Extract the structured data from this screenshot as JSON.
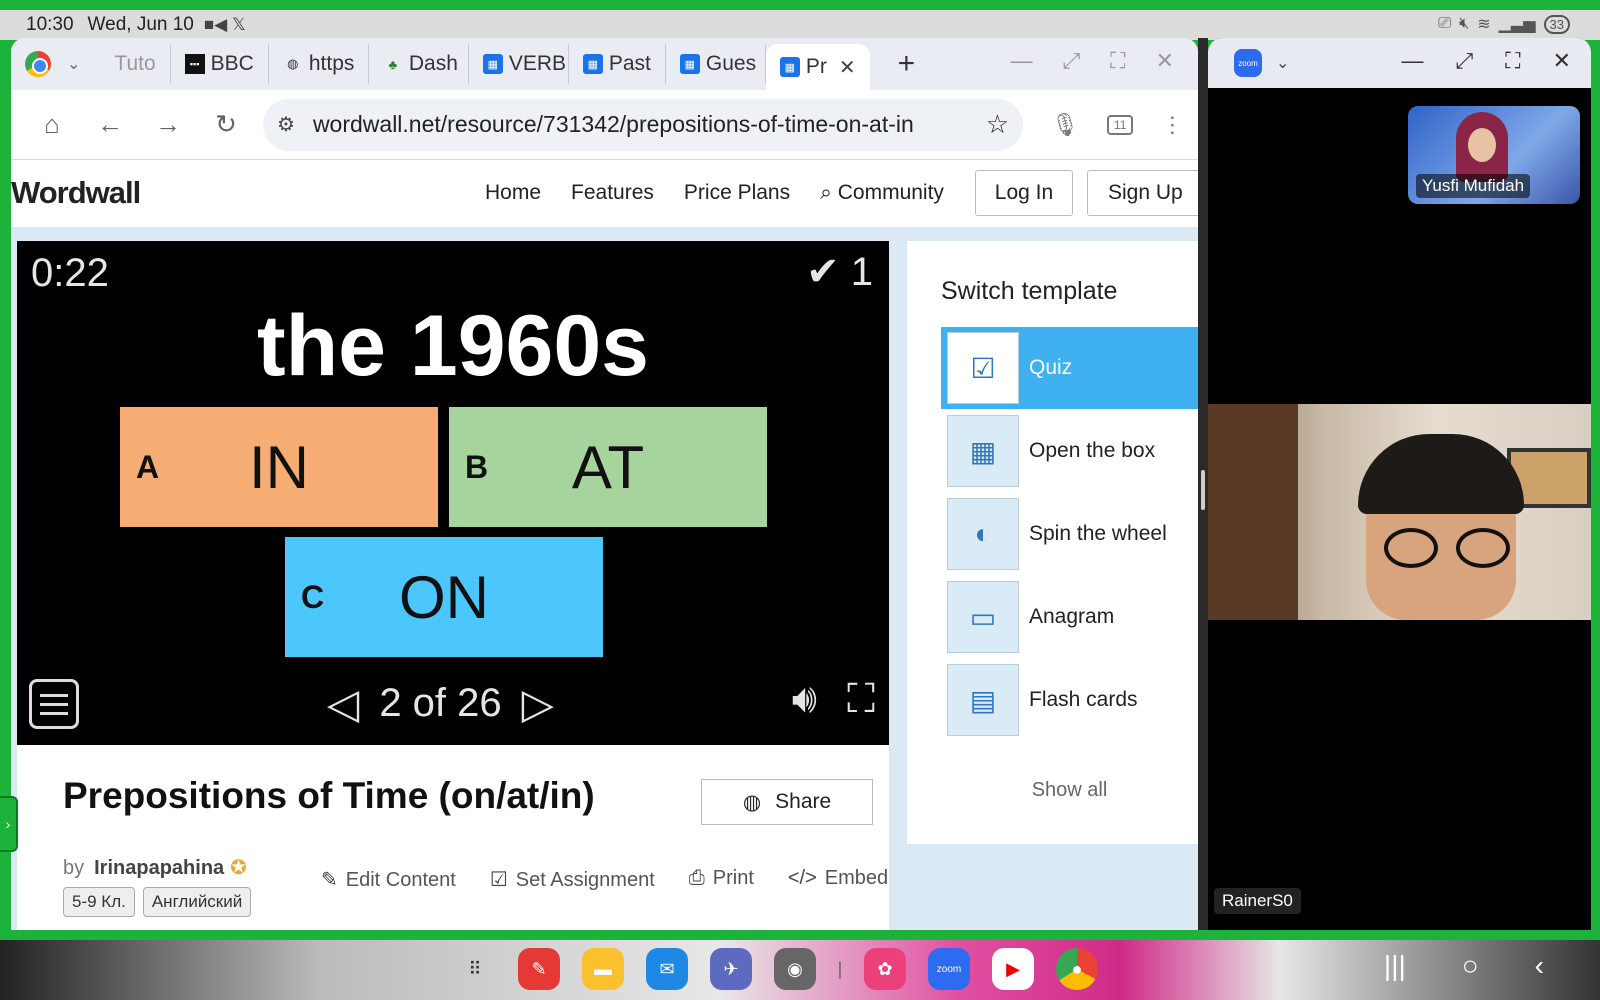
{
  "status_bar": {
    "time": "10:30",
    "date": "Wed, Jun 10",
    "battery": "33"
  },
  "browser": {
    "tabs": [
      {
        "label": "Tuto",
        "fav": "",
        "fav_type": "dim"
      },
      {
        "label": "BBC",
        "fav": "▪▪▪",
        "fav_type": "bbc"
      },
      {
        "label": "https",
        "fav": "◍",
        "fav_type": "globe"
      },
      {
        "label": "Dash",
        "fav": "♣",
        "fav_type": "dash"
      },
      {
        "label": "VERB",
        "fav": "▦",
        "fav_type": "ww"
      },
      {
        "label": "Past",
        "fav": "▦",
        "fav_type": "ww"
      },
      {
        "label": "Gues",
        "fav": "▦",
        "fav_type": "ww"
      },
      {
        "label": "Pr",
        "fav": "▦",
        "fav_type": "ww"
      }
    ],
    "url": "wordwall.net/resource/731342/prepositions-of-time-on-at-in",
    "tab_count": "11"
  },
  "site": {
    "logo": "Wordwall",
    "nav": [
      "Home",
      "Features",
      "Price Plans",
      "Community"
    ],
    "login": "Log In",
    "signup": "Sign Up"
  },
  "game": {
    "timer": "0:22",
    "score": "✔ 1",
    "question": "the 1960s",
    "answers": [
      {
        "letter": "A",
        "text": "IN",
        "color": "#f5ad73"
      },
      {
        "letter": "B",
        "text": "AT",
        "color": "#a6d49c"
      },
      {
        "letter": "C",
        "text": "ON",
        "color": "#4cc7fb"
      }
    ],
    "pager": "2 of 26"
  },
  "activity": {
    "title": "Prepositions of Time (on/at/in)",
    "share": "Share",
    "by": "by",
    "author": "Irinapapahina",
    "tags": [
      "5-9 Кл.",
      "Английский"
    ],
    "actions": [
      "Edit Content",
      "Set Assignment",
      "Print",
      "Embed"
    ]
  },
  "switch_template": {
    "title": "Switch template",
    "items": [
      "Quiz",
      "Open the box",
      "Spin the wheel",
      "Anagram",
      "Flash cards"
    ],
    "show_all": "Show all"
  },
  "zoom": {
    "participant_1": "Yusfi Mufidah",
    "participant_2": "RainerS0"
  },
  "colors": {
    "frame_green": "#1db33a",
    "active_template": "#3fb0f0"
  }
}
